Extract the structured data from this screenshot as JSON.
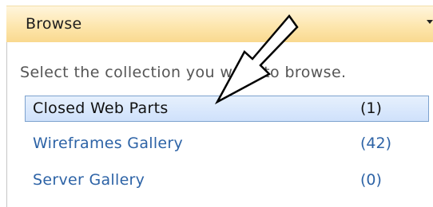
{
  "panel": {
    "title": "Browse",
    "dropdown_icon": "chevron-down-icon",
    "instruction": "Select the collection you want to browse.",
    "items": [
      {
        "label": "Closed Web Parts",
        "count": "(1)",
        "selected": true
      },
      {
        "label": "Wireframes Gallery",
        "count": "(42)",
        "selected": false
      },
      {
        "label": "Server Gallery",
        "count": "(0)",
        "selected": false
      }
    ]
  },
  "annotation": {
    "icon": "arrow-pointer-icon",
    "colors": {
      "fill": "#ffffff",
      "stroke": "#000000"
    }
  },
  "colors": {
    "header_gradient_top": "#fff5dc",
    "header_gradient_bottom": "#f9d98f",
    "selected_bg": "#cfe1fb",
    "selected_border": "#7da2ce",
    "link": "#2d63a6",
    "instruction_text": "#555555"
  }
}
